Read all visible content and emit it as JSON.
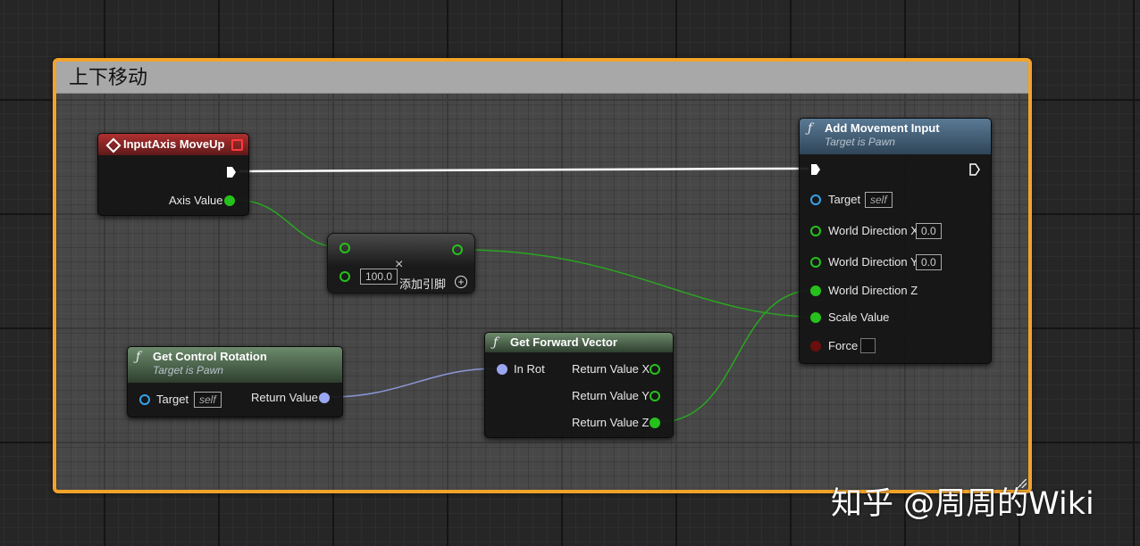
{
  "comment": {
    "title": "上下移动"
  },
  "nodes": {
    "input_axis": {
      "title": "InputAxis MoveUp",
      "axis_value_label": "Axis Value"
    },
    "multiply": {
      "value_b": "100.0",
      "add_pin_label": "添加引脚",
      "operator_symbol": "×"
    },
    "get_control_rotation": {
      "title": "Get Control Rotation",
      "subtitle": "Target is Pawn",
      "target_label": "Target",
      "target_value": "self",
      "return_label": "Return Value"
    },
    "get_forward_vector": {
      "title": "Get Forward Vector",
      "in_rot_label": "In Rot",
      "return_x_label": "Return Value X",
      "return_y_label": "Return Value Y",
      "return_z_label": "Return Value Z"
    },
    "add_movement_input": {
      "title": "Add Movement Input",
      "subtitle": "Target is Pawn",
      "target_label": "Target",
      "target_value": "self",
      "world_dir_x_label": "World Direction X",
      "world_dir_x_value": "0.0",
      "world_dir_y_label": "World Direction Y",
      "world_dir_y_value": "0.0",
      "world_dir_z_label": "World Direction Z",
      "scale_value_label": "Scale Value",
      "force_label": "Force"
    }
  },
  "icons": {
    "function": "ƒ",
    "event": "event-diamond-icon",
    "add_pin": "+"
  },
  "colors": {
    "comment_border": "#f2a32a",
    "float_pin": "#26c11c",
    "rotator_pin": "#9aa6f0",
    "object_pin": "#37a2e8",
    "bool_pin": "#6a0e0e",
    "exec_wire": "#ffffff"
  },
  "watermark": "知乎 @周周的Wiki"
}
